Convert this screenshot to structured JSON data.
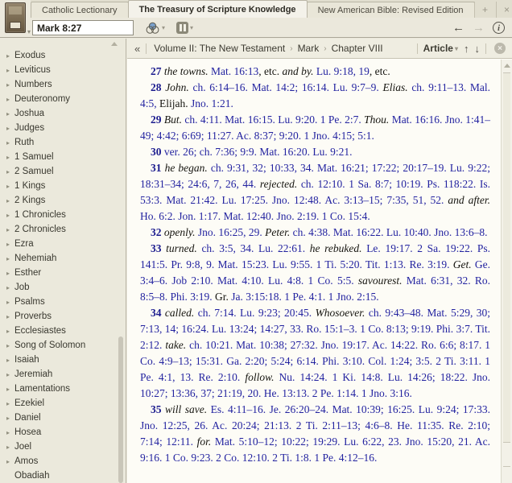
{
  "tabs": {
    "items": [
      {
        "label": "Catholic Lectionary",
        "active": false
      },
      {
        "label": "The Treasury of Scripture Knowledge",
        "active": true
      },
      {
        "label": "New American Bible: Revised Edition",
        "active": false
      }
    ],
    "new_tab_glyph": "+",
    "close_glyph": "×"
  },
  "toolbar": {
    "reference_value": "Mark 8:27",
    "icons": {
      "resource_cover": "book-cover",
      "visual_filter": "venn-circles",
      "parallel_resources": "parallel-bars",
      "back_glyph": "←",
      "forward_glyph": "→",
      "info_glyph": "i",
      "caret_glyph": "▾"
    }
  },
  "locator": {
    "collapse_glyph": "«",
    "breadcrumb": [
      "Volume II: The New Testament",
      "Mark",
      "Chapter VIII"
    ],
    "separator": "›",
    "view_mode": "Article",
    "up_glyph": "↑",
    "down_glyph": "↓",
    "close_glyph": "×"
  },
  "sidebar": {
    "items": [
      {
        "label": "Exodus",
        "expandable": true
      },
      {
        "label": "Leviticus",
        "expandable": true
      },
      {
        "label": "Numbers",
        "expandable": true
      },
      {
        "label": "Deuteronomy",
        "expandable": true
      },
      {
        "label": "Joshua",
        "expandable": true
      },
      {
        "label": "Judges",
        "expandable": true
      },
      {
        "label": "Ruth",
        "expandable": true
      },
      {
        "label": "1 Samuel",
        "expandable": true
      },
      {
        "label": "2 Samuel",
        "expandable": true
      },
      {
        "label": "1 Kings",
        "expandable": true
      },
      {
        "label": "2 Kings",
        "expandable": true
      },
      {
        "label": "1 Chronicles",
        "expandable": true
      },
      {
        "label": "2 Chronicles",
        "expandable": true
      },
      {
        "label": "Ezra",
        "expandable": true
      },
      {
        "label": "Nehemiah",
        "expandable": true
      },
      {
        "label": "Esther",
        "expandable": true
      },
      {
        "label": "Job",
        "expandable": true
      },
      {
        "label": "Psalms",
        "expandable": true
      },
      {
        "label": "Proverbs",
        "expandable": true
      },
      {
        "label": "Ecclesiastes",
        "expandable": true
      },
      {
        "label": "Song of Solomon",
        "expandable": true
      },
      {
        "label": "Isaiah",
        "expandable": true
      },
      {
        "label": "Jeremiah",
        "expandable": true
      },
      {
        "label": "Lamentations",
        "expandable": true
      },
      {
        "label": "Ezekiel",
        "expandable": true
      },
      {
        "label": "Daniel",
        "expandable": true
      },
      {
        "label": "Hosea",
        "expandable": true
      },
      {
        "label": "Joel",
        "expandable": true
      },
      {
        "label": "Amos",
        "expandable": true
      },
      {
        "label": "Obadiah",
        "expandable": false
      }
    ]
  },
  "article": {
    "paragraphs": [
      {
        "verse": "27",
        "segments": [
          [
            "27",
            "n"
          ],
          [
            " ",
            "p"
          ],
          [
            "the towns.",
            "i"
          ],
          [
            " ",
            "p"
          ],
          [
            "Mat. 16:13",
            "r"
          ],
          [
            ", etc. ",
            "p"
          ],
          [
            "and by.",
            "i"
          ],
          [
            " ",
            "p"
          ],
          [
            "Lu. 9:18, 19",
            "r"
          ],
          [
            ", etc.",
            "p"
          ]
        ]
      },
      {
        "verse": "28",
        "segments": [
          [
            "28",
            "n"
          ],
          [
            " ",
            "p"
          ],
          [
            "John.",
            "i"
          ],
          [
            " ",
            "p"
          ],
          [
            "ch. 6:14–16. Mat. 14:2; 16:14. Lu. 9:7–9.",
            "r"
          ],
          [
            " ",
            "p"
          ],
          [
            "Elias.",
            "i"
          ],
          [
            " ",
            "p"
          ],
          [
            "ch. 9:11–13. Mal. 4:5,",
            "r"
          ],
          [
            " Elijah. ",
            "p"
          ],
          [
            "Jno. 1:21.",
            "r"
          ]
        ]
      },
      {
        "verse": "29",
        "segments": [
          [
            "29",
            "n"
          ],
          [
            " ",
            "p"
          ],
          [
            "But.",
            "i"
          ],
          [
            " ",
            "p"
          ],
          [
            "ch. 4:11. Mat. 16:15. Lu. 9:20. 1 Pe. 2:7.",
            "r"
          ],
          [
            " ",
            "p"
          ],
          [
            "Thou.",
            "i"
          ],
          [
            " ",
            "p"
          ],
          [
            "Mat. 16:16. Jno. 1:41–49; 4:42; 6:69; 11:27. Ac. 8:37; 9:20. 1 Jno. 4:15; 5:1.",
            "r"
          ]
        ]
      },
      {
        "verse": "30",
        "segments": [
          [
            "30",
            "n"
          ],
          [
            " ",
            "p"
          ],
          [
            "ver. 26; ch. 7:36; 9:9. Mat. 16:20. Lu. 9:21.",
            "r"
          ]
        ]
      },
      {
        "verse": "31",
        "segments": [
          [
            "31",
            "n"
          ],
          [
            " ",
            "p"
          ],
          [
            "he began.",
            "i"
          ],
          [
            " ",
            "p"
          ],
          [
            "ch. 9:31, 32; 10:33, 34. Mat. 16:21; 17:22; 20:17–19. Lu. 9:22; 18:31–34; 24:6, 7, 26, 44.",
            "r"
          ],
          [
            " ",
            "p"
          ],
          [
            "rejected.",
            "i"
          ],
          [
            " ",
            "p"
          ],
          [
            "ch. 12:10. 1 Sa. 8:7; 10:19. Ps. 118:22. Is. 53:3. Mat. 21:42. Lu. 17:25. Jno. 12:48. Ac. 3:13–15; 7:35, 51, 52.",
            "r"
          ],
          [
            " ",
            "p"
          ],
          [
            "and after.",
            "i"
          ],
          [
            " ",
            "p"
          ],
          [
            "Ho. 6:2. Jon. 1:17. Mat. 12:40. Jno. 2:19. 1 Co. 15:4.",
            "r"
          ]
        ]
      },
      {
        "verse": "32",
        "segments": [
          [
            "32",
            "n"
          ],
          [
            " ",
            "p"
          ],
          [
            "openly.",
            "i"
          ],
          [
            " ",
            "p"
          ],
          [
            "Jno. 16:25, 29.",
            "r"
          ],
          [
            " ",
            "p"
          ],
          [
            "Peter.",
            "i"
          ],
          [
            " ",
            "p"
          ],
          [
            "ch. 4:38. Mat. 16:22. Lu. 10:40. Jno. 13:6–8.",
            "r"
          ]
        ]
      },
      {
        "verse": "33",
        "segments": [
          [
            "33",
            "n"
          ],
          [
            " ",
            "p"
          ],
          [
            "turned.",
            "i"
          ],
          [
            " ",
            "p"
          ],
          [
            "ch. 3:5, 34. Lu. 22:61.",
            "r"
          ],
          [
            " ",
            "p"
          ],
          [
            "he rebuked.",
            "i"
          ],
          [
            " ",
            "p"
          ],
          [
            "Le. 19:17. 2 Sa. 19:22. Ps. 141:5. Pr. 9:8, 9. Mat. 15:23. Lu. 9:55. 1 Ti. 5:20. Tit. 1:13. Re. 3:19.",
            "r"
          ],
          [
            " ",
            "p"
          ],
          [
            "Get.",
            "i"
          ],
          [
            " ",
            "p"
          ],
          [
            "Ge. 3:4–6. Job 2:10. Mat. 4:10. Lu. 4:8. 1 Co. 5:5.",
            "r"
          ],
          [
            " ",
            "p"
          ],
          [
            "savourest.",
            "i"
          ],
          [
            " ",
            "p"
          ],
          [
            "Mat. 6:31, 32. Ro. 8:5–8. Phi. 3:19.",
            "r"
          ],
          [
            " Gr. ",
            "p"
          ],
          [
            "Ja. 3:15:18. 1 Pe. 4:1. 1 Jno. 2:15.",
            "r"
          ]
        ]
      },
      {
        "verse": "34",
        "segments": [
          [
            "34",
            "n"
          ],
          [
            " ",
            "p"
          ],
          [
            "called.",
            "i"
          ],
          [
            " ",
            "p"
          ],
          [
            "ch. 7:14. Lu. 9:23; 20:45.",
            "r"
          ],
          [
            " ",
            "p"
          ],
          [
            "Whosoever.",
            "i"
          ],
          [
            " ",
            "p"
          ],
          [
            "ch. 9:43–48. Mat. 5:29, 30; 7:13, 14; 16:24. Lu. 13:24; 14:27, 33. Ro. 15:1–3. 1 Co. 8:13; 9:19. Phi. 3:7. Tit. 2:12.",
            "r"
          ],
          [
            " ",
            "p"
          ],
          [
            "take.",
            "i"
          ],
          [
            " ",
            "p"
          ],
          [
            "ch. 10:21. Mat. 10:38; 27:32. Jno. 19:17. Ac. 14:22. Ro. 6:6; 8:17. 1 Co. 4:9–13; 15:31. Ga. 2:20; 5:24; 6:14. Phi. 3:10. Col. 1:24; 3:5. 2 Ti. 3:11. 1 Pe. 4:1, 13. Re. 2:10.",
            "r"
          ],
          [
            " ",
            "p"
          ],
          [
            "follow.",
            "i"
          ],
          [
            " ",
            "p"
          ],
          [
            "Nu. 14:24. 1 Ki. 14:8. Lu. 14:26; 18:22. Jno. 10:27; 13:36, 37; 21:19, 20. He. 13:13. 2 Pe. 1:14. 1 Jno. 3:16.",
            "r"
          ]
        ]
      },
      {
        "verse": "35",
        "segments": [
          [
            "35",
            "n"
          ],
          [
            " ",
            "p"
          ],
          [
            "will save.",
            "i"
          ],
          [
            " ",
            "p"
          ],
          [
            "Es. 4:11–16. Je. 26:20–24. Mat. 10:39; 16:25. Lu. 9:24; 17:33. Jno. 12:25, 26. Ac. 20:24; 21:13. 2 Ti. 2:11–13; 4:6–8. He. 11:35. Re. 2:10; 7:14; 12:11.",
            "r"
          ],
          [
            " ",
            "p"
          ],
          [
            "for.",
            "i"
          ],
          [
            " ",
            "p"
          ],
          [
            "Mat. 5:10–12; 10:22; 19:29. Lu. 6:22, 23. Jno. 15:20, 21. Ac. 9:16. 1 Co. 9:23. 2 Co. 12:10. 2 Ti. 1:8. 1 Pe. 4:12–16.",
            "r"
          ]
        ]
      }
    ]
  },
  "colors": {
    "chrome_bg": "#ebe8dc",
    "sidebar_bg": "#ebe9dc",
    "content_bg": "#fdfcf6",
    "active_tab_bg": "#f4f2ea",
    "link_blue": "#2323a0",
    "verse_number_blue": "#1b1b8e",
    "venn_fill_blue": "#7aa0cc"
  }
}
